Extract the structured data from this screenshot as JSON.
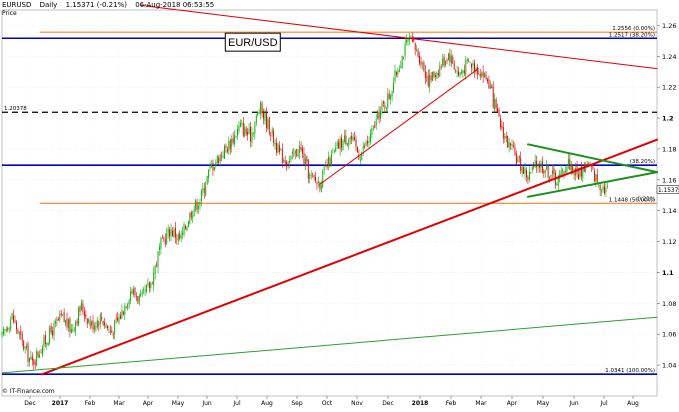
{
  "header": {
    "symbol": "EURUSD",
    "period": "Daily",
    "last_change": "1.15371 (-0.21%)",
    "datetime": "06-Aug-2018 06:53:55"
  },
  "price_label": "Price",
  "credit": "© IT-Finance.com",
  "title_box": "EUR/USD",
  "colors": {
    "up_candle": "#00b000",
    "down_candle": "#e00000",
    "fib_orange": "#ff7f2a",
    "support_blue": "#0000cc",
    "trend_red": "#e00000",
    "trend_green": "#2ca02c",
    "dashed_black": "#000000"
  },
  "chart_data": {
    "type": "candlestick",
    "title": "EUR/USD",
    "ylim": [
      1.02,
      1.27
    ],
    "y_ticks": [
      "1.04",
      "1.06",
      "1.08",
      "1.1",
      "1.12",
      "1.14",
      "1.16",
      "1.18",
      "1.2",
      "1.22",
      "1.24",
      "1.26"
    ],
    "x_ticks": [
      "Dec",
      "2017",
      "Feb",
      "Mar",
      "Apr",
      "May",
      "Jun",
      "Jul",
      "Aug",
      "Sep",
      "Oct",
      "Nov",
      "Dec",
      "2018",
      "Feb",
      "Mar",
      "Apr",
      "May",
      "Jun",
      "Jul",
      "Aug"
    ],
    "last_price": "1.15371",
    "last_change_pct": "-0.21%",
    "close_path": [
      {
        "t": 0,
        "v": 1.058
      },
      {
        "t": 1,
        "v": 1.072
      },
      {
        "t": 2,
        "v": 1.055
      },
      {
        "t": 3,
        "v": 1.041
      },
      {
        "t": 4,
        "v": 1.052
      },
      {
        "t": 5,
        "v": 1.062
      },
      {
        "t": 6,
        "v": 1.071
      },
      {
        "t": 7,
        "v": 1.063
      },
      {
        "t": 8,
        "v": 1.078
      },
      {
        "t": 9,
        "v": 1.066
      },
      {
        "t": 10,
        "v": 1.071
      },
      {
        "t": 11,
        "v": 1.061
      },
      {
        "t": 12,
        "v": 1.073
      },
      {
        "t": 13,
        "v": 1.089
      },
      {
        "t": 14,
        "v": 1.082
      },
      {
        "t": 15,
        "v": 1.093
      },
      {
        "t": 16,
        "v": 1.118
      },
      {
        "t": 17,
        "v": 1.128
      },
      {
        "t": 18,
        "v": 1.121
      },
      {
        "t": 19,
        "v": 1.139
      },
      {
        "t": 20,
        "v": 1.148
      },
      {
        "t": 21,
        "v": 1.168
      },
      {
        "t": 22,
        "v": 1.176
      },
      {
        "t": 23,
        "v": 1.184
      },
      {
        "t": 24,
        "v": 1.195
      },
      {
        "t": 25,
        "v": 1.188
      },
      {
        "t": 26,
        "v": 1.207
      },
      {
        "t": 27,
        "v": 1.193
      },
      {
        "t": 28,
        "v": 1.176
      },
      {
        "t": 29,
        "v": 1.172
      },
      {
        "t": 30,
        "v": 1.181
      },
      {
        "t": 31,
        "v": 1.162
      },
      {
        "t": 32,
        "v": 1.158
      },
      {
        "t": 33,
        "v": 1.172
      },
      {
        "t": 34,
        "v": 1.183
      },
      {
        "t": 35,
        "v": 1.189
      },
      {
        "t": 36,
        "v": 1.176
      },
      {
        "t": 37,
        "v": 1.186
      },
      {
        "t": 38,
        "v": 1.203
      },
      {
        "t": 39,
        "v": 1.214
      },
      {
        "t": 40,
        "v": 1.235
      },
      {
        "t": 41,
        "v": 1.251
      },
      {
        "t": 42,
        "v": 1.241
      },
      {
        "t": 43,
        "v": 1.224
      },
      {
        "t": 44,
        "v": 1.232
      },
      {
        "t": 45,
        "v": 1.242
      },
      {
        "t": 46,
        "v": 1.228
      },
      {
        "t": 47,
        "v": 1.236
      },
      {
        "t": 48,
        "v": 1.232
      },
      {
        "t": 49,
        "v": 1.224
      },
      {
        "t": 50,
        "v": 1.199
      },
      {
        "t": 51,
        "v": 1.183
      },
      {
        "t": 52,
        "v": 1.172
      },
      {
        "t": 53,
        "v": 1.162
      },
      {
        "t": 54,
        "v": 1.171
      },
      {
        "t": 55,
        "v": 1.166
      },
      {
        "t": 56,
        "v": 1.159
      },
      {
        "t": 57,
        "v": 1.172
      },
      {
        "t": 58,
        "v": 1.163
      },
      {
        "t": 59,
        "v": 1.171
      },
      {
        "t": 60,
        "v": 1.159
      },
      {
        "t": 61,
        "v": 1.1537
      }
    ],
    "horizontal_levels": [
      {
        "name": "fib-0",
        "value": 1.2556,
        "label": "1.2556 (0.00%)",
        "color": "#ff7f2a",
        "style": "solid"
      },
      {
        "name": "fib-382-blue",
        "value": 1.2517,
        "label": "1.2517 (38.20%)",
        "color": "#0000cc",
        "style": "solid"
      },
      {
        "name": "level-1-2037",
        "value": 1.20378,
        "label": "1.20378",
        "color": "#000000",
        "style": "dashed"
      },
      {
        "name": "support-blue-mid",
        "value": 1.1695,
        "label": "(38.20%)",
        "color": "#0000cc",
        "style": "solid"
      },
      {
        "name": "fib-50",
        "value": 1.1448,
        "label": "1.1448 (50.00%)",
        "color": "#ff7f2a",
        "style": "solid"
      },
      {
        "name": "fib-100",
        "value": 1.0341,
        "label": "1.0341 (100.00%)",
        "color": "#0000cc",
        "style": "solid"
      }
    ],
    "trend_lines": [
      {
        "name": "top-downtrend",
        "from": {
          "t": 14,
          "v": 1.273
        },
        "to": {
          "t": 66,
          "v": 1.232
        },
        "color": "#e00000",
        "width": 1
      },
      {
        "name": "major-uptrend",
        "from": {
          "t": 4,
          "v": 1.034
        },
        "to": {
          "t": 66,
          "v": 1.186
        },
        "color": "#e00000",
        "width": 2
      },
      {
        "name": "minor-uptrend",
        "from": {
          "t": 32,
          "v": 1.157
        },
        "to": {
          "t": 48,
          "v": 1.232
        },
        "color": "#e00000",
        "width": 1
      },
      {
        "name": "long-green-support",
        "from": {
          "t": 0,
          "v": 1.035
        },
        "to": {
          "t": 66,
          "v": 1.071
        },
        "color": "#2ca02c",
        "width": 1
      },
      {
        "name": "triangle-upper",
        "from": {
          "t": 53,
          "v": 1.183
        },
        "to": {
          "t": 66,
          "v": 1.165
        },
        "color": "#1a8f1a",
        "width": 2
      },
      {
        "name": "triangle-lower",
        "from": {
          "t": 53,
          "v": 1.149
        },
        "to": {
          "t": 66,
          "v": 1.165
        },
        "color": "#1a8f1a",
        "width": 2
      }
    ]
  }
}
